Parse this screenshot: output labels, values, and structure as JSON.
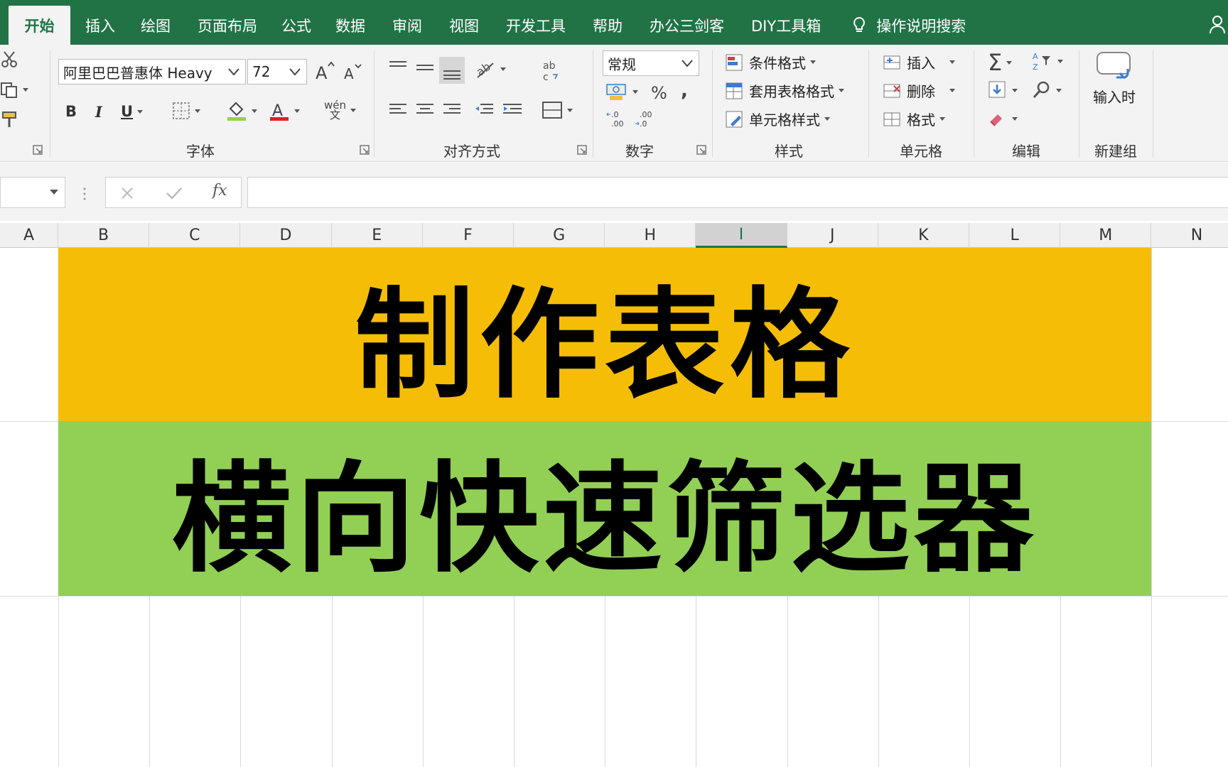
{
  "tabs": [
    "开始",
    "插入",
    "绘图",
    "页面布局",
    "公式",
    "数据",
    "审阅",
    "视图",
    "开发工具",
    "帮助",
    "办公三剑客",
    "DIY工具箱"
  ],
  "tell_me": "操作说明搜索",
  "font": {
    "name": "阿里巴巴普惠体 Heavy",
    "size": "72",
    "phonetic": "wén"
  },
  "number": {
    "format": "常规",
    "percent": "%",
    "comma": ","
  },
  "styles": {
    "conditional": "条件格式",
    "table": "套用表格格式",
    "cell": "单元格样式"
  },
  "cells": {
    "insert": "插入",
    "delete": "删除",
    "format": "格式"
  },
  "newgroup": {
    "button": "输入时"
  },
  "groups": {
    "font": "字体",
    "align": "对齐方式",
    "number": "数字",
    "styles": "样式",
    "cells": "单元格",
    "editing": "编辑",
    "newgroup": "新建组"
  },
  "formula_bar": {
    "fx": "fx",
    "value": ""
  },
  "columns": [
    "A",
    "B",
    "C",
    "D",
    "E",
    "F",
    "G",
    "H",
    "I",
    "J",
    "K",
    "L",
    "M",
    "N"
  ],
  "selected_column": "I",
  "banner": {
    "line1": "制作表格",
    "line2": "横向快速筛选器",
    "color1": "#f5bd06",
    "color2": "#92cf55"
  },
  "accent_color": "#217346"
}
